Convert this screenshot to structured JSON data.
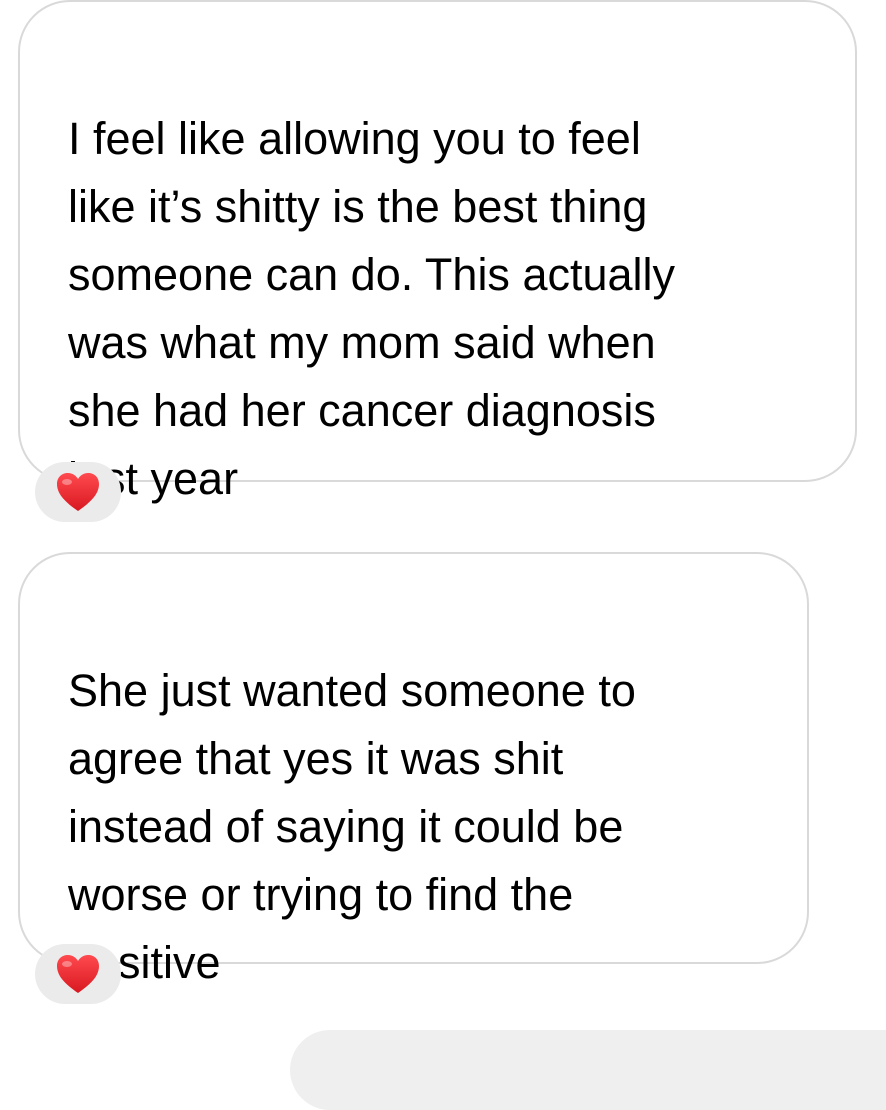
{
  "messages": [
    {
      "text": "I feel like allowing you to feel\nlike it’s shitty is the best thing\nsomeone can do. This actually\nwas what my mom said when\nshe had her cancer diagnosis\nlast year",
      "reaction": "heart-icon"
    },
    {
      "text": "She just wanted someone to\nagree that yes it was shit\ninstead of saying it could be\nworse or trying to find the\npositive",
      "reaction": "heart-icon"
    }
  ],
  "colors": {
    "bubble_border": "#d9d9d9",
    "reaction_bg": "#ebebeb",
    "heart": "#e8232b"
  }
}
